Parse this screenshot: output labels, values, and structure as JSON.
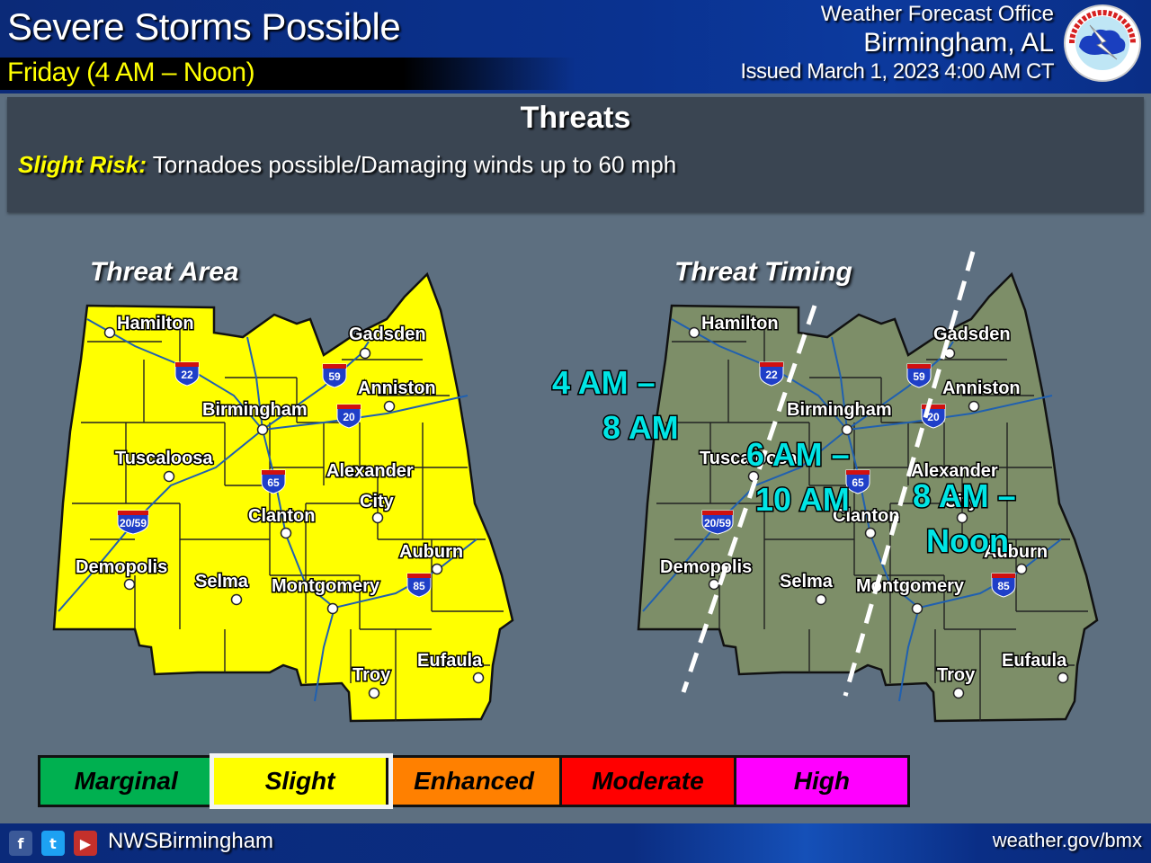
{
  "header": {
    "title": "Severe Storms Possible",
    "subtitle": "Friday (4 AM – Noon)",
    "office_line1": "Weather Forecast Office",
    "office_line2": "Birmingham, AL",
    "issued": "Issued March 1, 2023 4:00 AM CT",
    "logo": "nws-logo-icon"
  },
  "threats": {
    "heading": "Threats",
    "risk_label": "Slight Risk:",
    "risk_text": "Tornadoes possible/Damaging winds up to 60 mph"
  },
  "threat_area": {
    "title": "Threat Area",
    "fill_color": "#ffff00"
  },
  "threat_timing": {
    "title": "Threat Timing",
    "fill_color": "#7d8e68",
    "windows": [
      {
        "line1": "4 AM –",
        "line2": "8 AM"
      },
      {
        "line1": "6 AM –",
        "line2": "10 AM"
      },
      {
        "line1": "8 AM –",
        "line2": "Noon"
      }
    ],
    "label_color": "#00e5e5"
  },
  "cities": [
    "Hamilton",
    "Gadsden",
    "Anniston",
    "Birmingham",
    "Tuscaloosa",
    "Alexander City",
    "Clanton",
    "Auburn",
    "Demopolis",
    "Selma",
    "Montgomery",
    "Troy",
    "Eufaula"
  ],
  "interstates": [
    "22",
    "59",
    "20",
    "65",
    "20/59",
    "85"
  ],
  "legend": {
    "items": [
      {
        "label": "Marginal",
        "color": "#00b050",
        "active": false
      },
      {
        "label": "Slight",
        "color": "#ffff00",
        "active": true
      },
      {
        "label": "Enhanced",
        "color": "#ff8000",
        "active": false
      },
      {
        "label": "Moderate",
        "color": "#ff0000",
        "active": false
      },
      {
        "label": "High",
        "color": "#ff00ff",
        "active": false
      }
    ]
  },
  "footer": {
    "social": [
      {
        "name": "facebook-icon",
        "glyph": "f",
        "color": "#3b5998"
      },
      {
        "name": "twitter-icon",
        "glyph": "t",
        "color": "#1da1f2"
      },
      {
        "name": "youtube-icon",
        "glyph": "▶",
        "color": "#c4302b"
      }
    ],
    "handle": "NWSBirmingham",
    "website": "weather.gov/bmx"
  }
}
